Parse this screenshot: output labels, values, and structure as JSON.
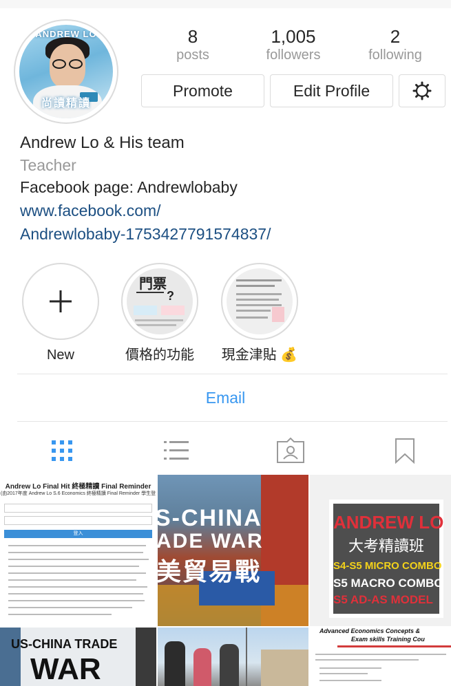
{
  "profile": {
    "stats": [
      {
        "value": "8",
        "label": "posts"
      },
      {
        "value": "1,005",
        "label": "followers"
      },
      {
        "value": "2",
        "label": "following"
      }
    ],
    "promote_label": "Promote",
    "edit_profile_label": "Edit Profile",
    "avatar_banner": "ANDREW LO",
    "avatar_bottom": "尚讀精讀"
  },
  "bio": {
    "name": "Andrew Lo & His team",
    "category": "Teacher",
    "text": "Facebook page: Andrewlobaby",
    "link_line1": "www.facebook.com/",
    "link_line2": "Andrewlobaby-1753427791574837/"
  },
  "highlights": [
    {
      "label": "New",
      "icon": "plus-icon"
    },
    {
      "label": "價格的功能",
      "cover_title": "門票",
      "cover_q": "?"
    },
    {
      "label": "現金津貼 💰"
    }
  ],
  "contact": {
    "email_label": "Email"
  },
  "tabs": [
    {
      "name": "grid",
      "icon": "grid-icon",
      "active": true
    },
    {
      "name": "list",
      "icon": "list-icon",
      "active": false
    },
    {
      "name": "tagged",
      "icon": "tagged-icon",
      "active": false
    },
    {
      "name": "saved",
      "icon": "bookmark-icon",
      "active": false
    }
  ],
  "posts": {
    "p1_title": "Andrew Lo Final Hit 終極精讀 Final Reminder",
    "p1_subtitle": "(由2017年度 Andrew Lo S.6 Economics 終極精讀 Final Reminder 學生登",
    "p1_button": "登入",
    "p2_line1": "S-CHINA",
    "p2_line2": "ADE WAR",
    "p2_line3": "美貿易戰",
    "p3_line1": "ANDREW LO",
    "p3_line2": "大考精讀班",
    "p3_line3": "S4-S5 MICRO COMBO",
    "p3_line4": "S5 MACRO COMBO",
    "p3_line5": "S5 AD-AS MODEL",
    "p4_line1": "US-CHINA TRADE",
    "p4_line2": "WAR",
    "p6_title": "Advanced Economics Concepts &",
    "p6_subtitle": "Exam skills Training Cou"
  },
  "colors": {
    "link": "#1c4f82",
    "accent": "#3897f0",
    "muted": "#999999",
    "border": "#dbdbdb",
    "p3_red": "#e0303a",
    "p3_yellow": "#f3d21a"
  }
}
